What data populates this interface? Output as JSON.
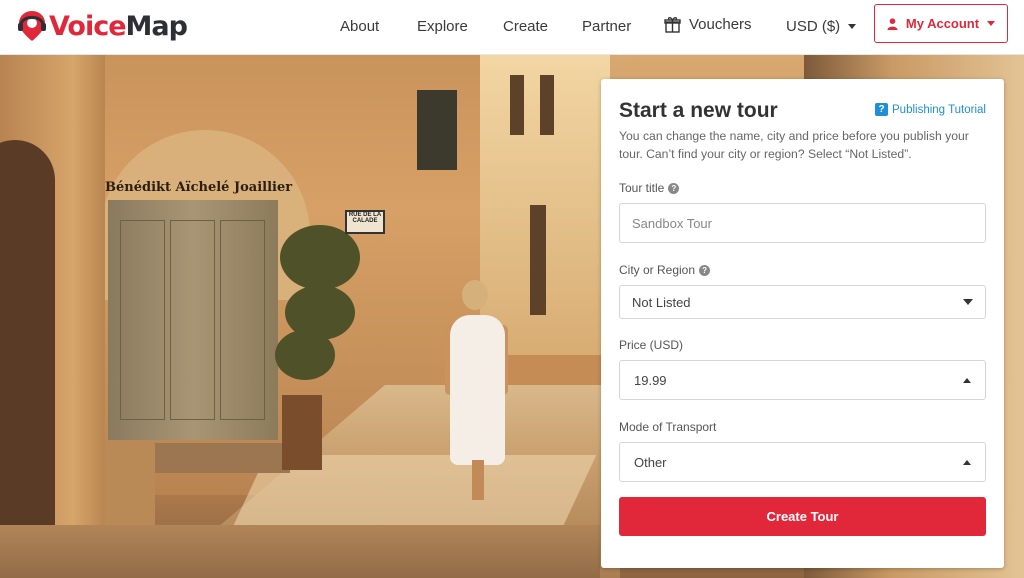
{
  "brand": {
    "logo_text_voice": "Voice",
    "logo_text_map": "Map",
    "accent_color": "#e0283a",
    "link_color": "#1f8fd6"
  },
  "nav": {
    "about": "About",
    "explore": "Explore",
    "create": "Create",
    "partner": "Partner",
    "vouchers": "Vouchers",
    "currency": "USD ($)",
    "account": "My Account"
  },
  "hero": {
    "shop_sign": "Bénédikt Aïchelé Joaillier",
    "blade_sign": "Bénédikt Aïchelé Joaillier",
    "street_sign": "RUE DE LA CALADE"
  },
  "form": {
    "title": "Start a new tour",
    "tutorial_link": "Publishing Tutorial",
    "description": "You can change the name, city and price before you publish your tour. Can’t find your city or region? Select “Not Listed”.",
    "tour_title_label": "Tour title",
    "tour_title_placeholder": "Sandbox Tour",
    "city_label": "City or Region",
    "city_value": "Not Listed",
    "price_label": "Price (USD)",
    "price_value": "19.99",
    "transport_label": "Mode of Transport",
    "transport_value": "Other",
    "submit_label": "Create Tour"
  }
}
